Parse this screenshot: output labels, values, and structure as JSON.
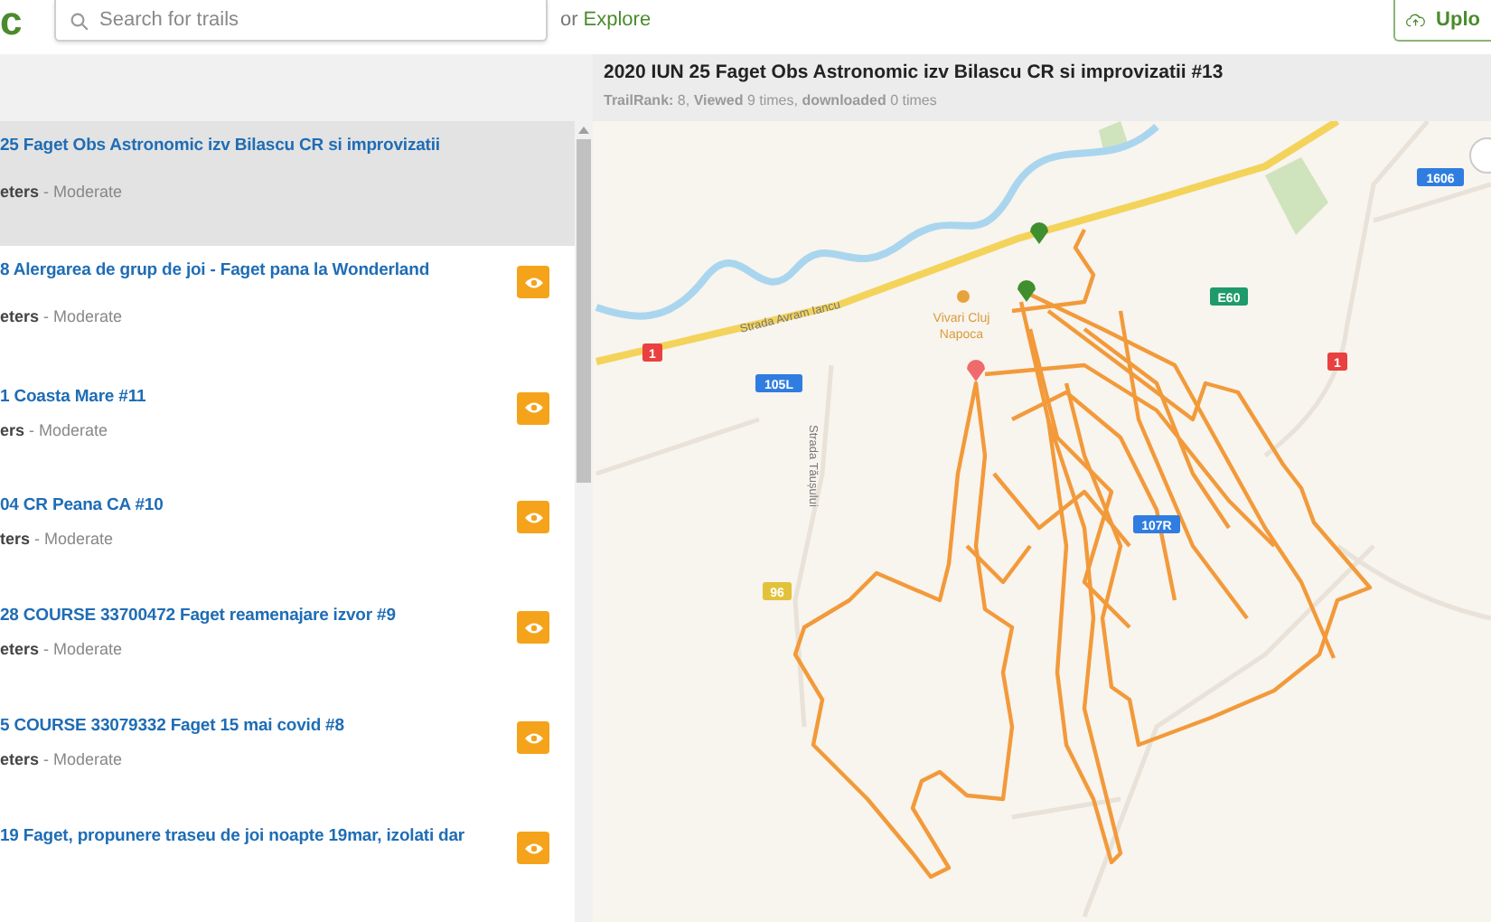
{
  "header": {
    "logo": "c",
    "search": {
      "placeholder": "Search for trails"
    },
    "explore_prefix": "or",
    "explore_link": "Explore",
    "upload_button": "Uplo"
  },
  "trail_list": [
    {
      "title": "25 Faget Obs Astronomic izv Bilascu CR si improvizatii",
      "meta": "**eters** - Moderate",
      "selected": true
    },
    {
      "title": "8 Alergarea de grup de joi - Faget pana la Wonderland",
      "meta": "**eters** - Moderate",
      "selected": false
    },
    {
      "title": "1 Coasta Mare #11",
      "meta": "**ers** - Moderate",
      "selected": false
    },
    {
      "title": "04 CR Peana CA #10",
      "meta": "**ters** - Moderate",
      "selected": false
    },
    {
      "title": "28 COURSE 33700472 Faget reamenajare izvor #9",
      "meta": "**eters** - Moderate",
      "selected": false
    },
    {
      "title": "5 COURSE 33079332 Faget 15 mai covid #8",
      "meta": "**eters** - Moderate",
      "selected": false
    },
    {
      "title": "19 Faget, propunere traseu de joi noapte 19mar, izolati dar",
      "selected": false
    }
  ],
  "detail": {
    "title": "2020 IUN 25 Faget Obs Astronomic izv Bilascu CR si improvizatii #13",
    "stats": "**TrailRank:** 8,  **Viewed** 9 times, **downloaded** 0 times"
  },
  "map": {
    "street_labels": [
      "Strada Avram Iancu",
      "Strada Tăușului"
    ],
    "poi_label": [
      "Vivari Cluj",
      "Napoca"
    ],
    "road_shields": [
      {
        "text": "1",
        "color": "#e8413f"
      },
      {
        "text": "105L",
        "color": "#2f7de0"
      },
      {
        "text": "96",
        "color": "#e2c23a"
      },
      {
        "text": "107R",
        "color": "#2f7de0"
      },
      {
        "text": "E60",
        "color": "#1f9a6a"
      },
      {
        "text": "1",
        "color": "#e8413f"
      },
      {
        "text": "1606",
        "color": "#2f7de0"
      }
    ]
  }
}
